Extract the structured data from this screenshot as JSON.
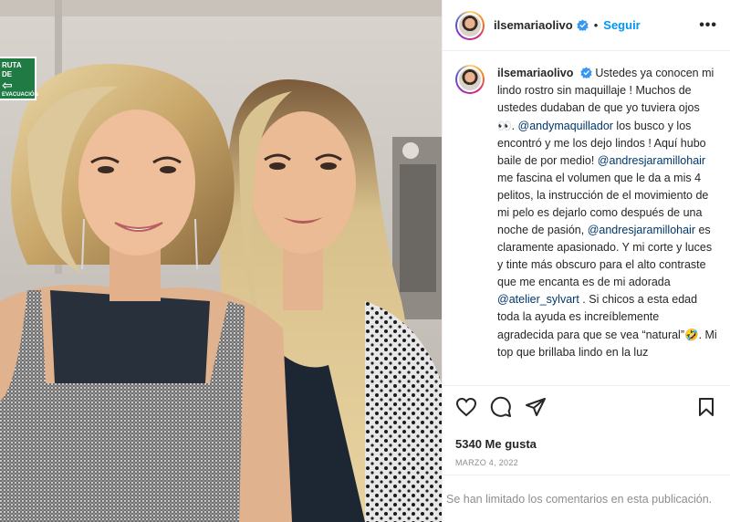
{
  "photo": {
    "sign_label": "RUTA DE",
    "sign_label2": "EVACUACIÓN",
    "sign_arrow": "⇦"
  },
  "header": {
    "username": "ilsemariaolivo",
    "separator": "•",
    "follow_label": "Seguir",
    "more_label": "•••"
  },
  "caption": {
    "username": "ilsemariaolivo",
    "text_1": "Ustedes ya conocen mi lindo rostro sin maquillaje ! Muchos de ustedes dudaban de que yo tuviera ojos ",
    "emoji_1": "👀",
    "text_2": ". ",
    "mention_1": "@andymaquillador",
    "text_3": " los busco y los encontró y me los dejo lindos ! Aquí hubo baile de por medio! ",
    "mention_2": "@andresjaramillohair",
    "text_4": " me fascina el volumen que le da a mis 4 pelitos, la instrucción de el movimiento de mi pelo es dejarlo como después de una noche de pasión, ",
    "mention_3": "@andresjaramillohair",
    "text_5": " es claramente apasionado. Y mi corte y luces y tinte más obscuro para el alto contraste que me encanta es de mi adorada ",
    "mention_4": "@atelier_sylvart",
    "text_6": " . Si chicos a esta edad toda la ayuda es increíblemente agradecida para que se vea “natural”",
    "emoji_2": "🤣",
    "text_7": ". Mi top que brillaba lindo en la luz"
  },
  "actions": {
    "likes": "5340 Me gusta",
    "date": "MARZO 4, 2022"
  },
  "comments": {
    "limited_text": "Se han limitado los comentarios en esta publicación."
  },
  "colors": {
    "accent": "#0095f6",
    "mention": "#00376b",
    "verified": "#3897f0",
    "muted": "#8e8e8e"
  }
}
